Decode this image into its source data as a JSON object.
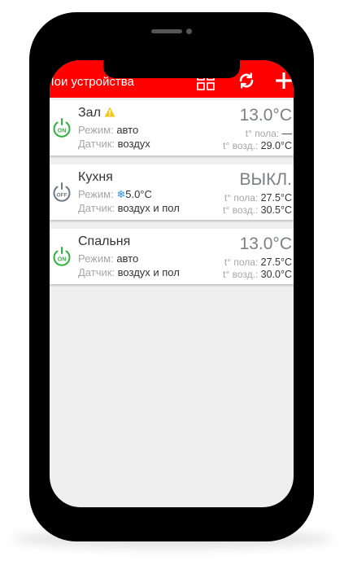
{
  "app": {
    "title": "Мои устройства",
    "icons": {
      "grid": "grid-view-icon",
      "refresh": "refresh-icon",
      "add": "add-icon"
    },
    "colors": {
      "accent": "#ff0000",
      "on": "#2eb33e",
      "off": "#6f7a89",
      "warning": "#f5c518",
      "frost": "#2f8fe0"
    }
  },
  "labels": {
    "mode": "Режим:",
    "sensor": "Датчик:",
    "floor_temp": "t° пола:",
    "air_temp": "t° возд.:"
  },
  "devices": [
    {
      "name": "Зал",
      "power": "ON",
      "warning": true,
      "mode": "авто",
      "sensor": "воздух",
      "setpoint": "13.0°C",
      "floor_temp": "—",
      "air_temp": "29.0°C"
    },
    {
      "name": "Кухня",
      "power": "OFF",
      "warning": false,
      "mode_icon": "snowflake-icon",
      "mode": "5.0°C",
      "sensor": "воздух и пол",
      "setpoint": "ВЫКЛ.",
      "floor_temp": "27.5°C",
      "air_temp": "30.5°C"
    },
    {
      "name": "Спальня",
      "power": "ON",
      "warning": false,
      "mode": "авто",
      "sensor": "воздух и пол",
      "setpoint": "13.0°C",
      "floor_temp": "27.5°C",
      "air_temp": "30.0°C"
    }
  ]
}
